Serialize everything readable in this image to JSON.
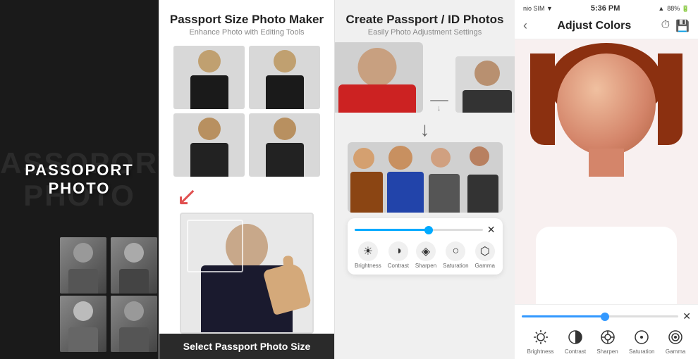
{
  "panel1": {
    "bg_text": "PASSOPORT",
    "title_line1": "PASSOPORT",
    "title_line2": "PHOTO"
  },
  "panel2": {
    "title": "Passport Size Photo Maker",
    "subtitle": "Enhance Photo with Editing Tools",
    "footer_text": "Select Passport Photo Size"
  },
  "panel3": {
    "title": "Create Passport / ID Photos",
    "subtitle": "Easily Photo Adjustment Settings",
    "toolbar": {
      "close_label": "✕",
      "icons": [
        {
          "label": "Brightness",
          "icon": "☀"
        },
        {
          "label": "Contrast",
          "icon": "◑"
        },
        {
          "label": "Sharpen",
          "icon": "◈"
        },
        {
          "label": "Saturation",
          "icon": "○"
        },
        {
          "label": "Gamma",
          "icon": "⬡"
        }
      ]
    }
  },
  "panel4": {
    "status_bar": {
      "left": "nio SIM ▼",
      "center": "5:36 PM",
      "right": "88% 🔋"
    },
    "nav": {
      "back_icon": "‹",
      "title": "Adjust Colors",
      "history_icon": "⏱",
      "save_icon": "💾"
    },
    "toolbar": {
      "close_label": "✕",
      "icons": [
        {
          "label": "Brightness",
          "icon": "☀"
        },
        {
          "label": "Contrast",
          "icon": "◑"
        },
        {
          "label": "Sharpen",
          "icon": "◈"
        },
        {
          "label": "Saturation",
          "icon": "○"
        },
        {
          "label": "Gamma",
          "icon": "⬡"
        }
      ]
    }
  }
}
